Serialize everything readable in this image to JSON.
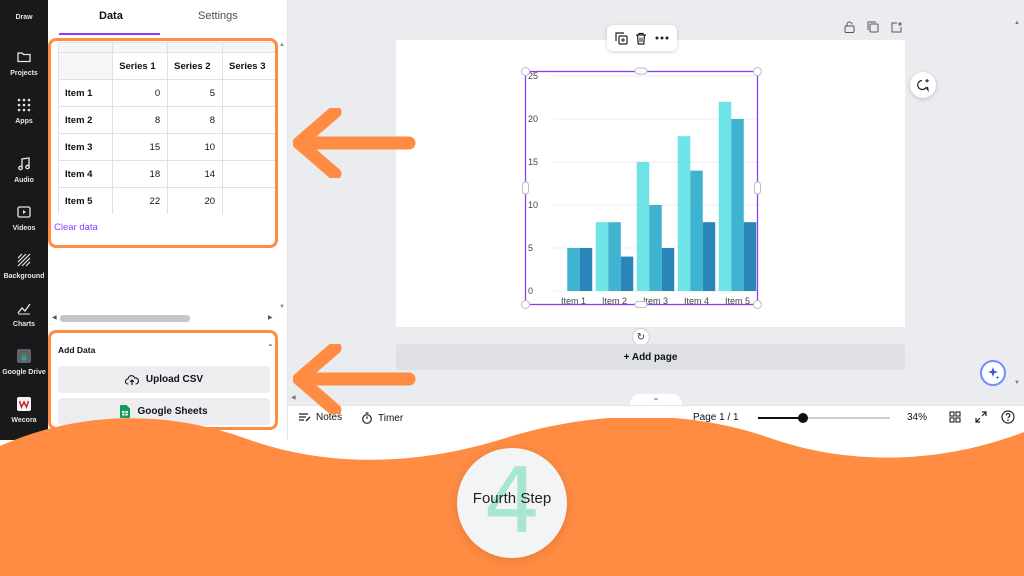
{
  "rail": {
    "items": [
      {
        "label": "Draw",
        "icon": "draw-icon"
      },
      {
        "label": "Projects",
        "icon": "folder-icon"
      },
      {
        "label": "Apps",
        "icon": "apps-grid-icon"
      },
      {
        "label": "Audio",
        "icon": "music-note-icon"
      },
      {
        "label": "Videos",
        "icon": "video-play-icon"
      },
      {
        "label": "Background",
        "icon": "background-hatch-icon"
      },
      {
        "label": "Charts",
        "icon": "chart-line-icon"
      },
      {
        "label": "Google Drive",
        "icon": "google-drive-icon"
      },
      {
        "label": "Wecora",
        "icon": "wecora-icon"
      }
    ]
  },
  "panel": {
    "tabs": {
      "data": "Data",
      "settings": "Settings"
    },
    "table": {
      "columns": [
        "Series 1",
        "Series 2",
        "Series 3"
      ],
      "rows": [
        {
          "label": "Item 1",
          "values": [
            "0",
            "5"
          ]
        },
        {
          "label": "Item 2",
          "values": [
            "8",
            "8"
          ]
        },
        {
          "label": "Item 3",
          "values": [
            "15",
            "10"
          ]
        },
        {
          "label": "Item 4",
          "values": [
            "18",
            "14"
          ]
        },
        {
          "label": "Item 5",
          "values": [
            "22",
            "20"
          ]
        }
      ]
    },
    "clear_data": "Clear data",
    "add_data": {
      "title": "Add Data",
      "upload_csv": "Upload CSV",
      "google_sheets": "Google Sheets"
    }
  },
  "canvas": {
    "add_page": "+ Add page"
  },
  "bottombar": {
    "notes": "Notes",
    "timer": "Timer",
    "page_indicator": "Page 1 / 1",
    "zoom": "34%",
    "zoom_fraction": 0.34
  },
  "step": {
    "number": "4",
    "label": "Fourth Step"
  },
  "colors": {
    "accent_purple": "#8b3dff",
    "highlight_orange": "#ff8c42",
    "series_1": "#6ee3e8",
    "series_2": "#3eb4d0",
    "series_3": "#2a86b9"
  },
  "chart_data": {
    "type": "bar",
    "categories": [
      "Item 1",
      "Item 2",
      "Item 3",
      "Item 4",
      "Item 5"
    ],
    "series": [
      {
        "values": [
          0,
          8,
          15,
          18,
          22
        ]
      },
      {
        "values": [
          5,
          8,
          10,
          14,
          20
        ]
      },
      {
        "values": [
          5,
          4,
          5,
          8,
          8
        ]
      }
    ],
    "y_ticks": [
      "0",
      "5",
      "10",
      "15",
      "20",
      "25"
    ],
    "ylim": [
      0,
      25
    ],
    "grid": true
  }
}
